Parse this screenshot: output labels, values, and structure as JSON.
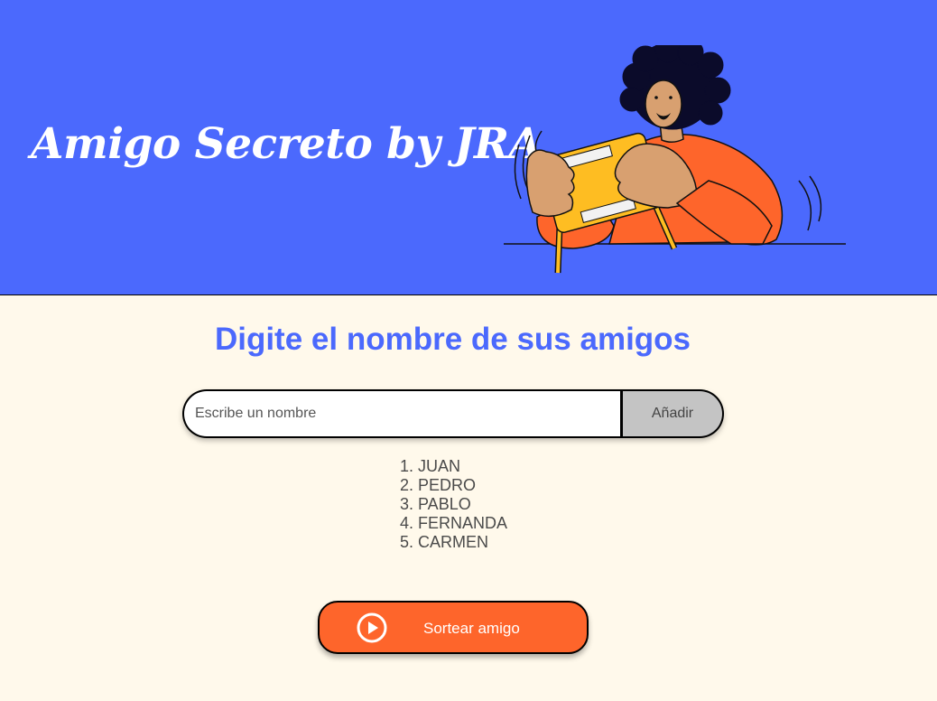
{
  "header": {
    "title": "Amigo Secreto by JRA"
  },
  "main": {
    "subtitle": "Digite el nombre de sus amigos",
    "input": {
      "placeholder": "Escribe un nombre",
      "value": ""
    },
    "add_button": "Añadir",
    "friends": [
      "1. JUAN",
      "2. PEDRO",
      "3. PABLO",
      "4. FERNANDA",
      "5. CARMEN"
    ],
    "draw_button": "Sortear amigo",
    "draw_button_icon": "play-circle-icon"
  },
  "colors": {
    "header_bg": "#4B69FD",
    "page_bg": "#FFF9EB",
    "accent": "#FE652B",
    "subtitle": "#4B69FD",
    "add_button_bg": "#C4C4C4"
  }
}
